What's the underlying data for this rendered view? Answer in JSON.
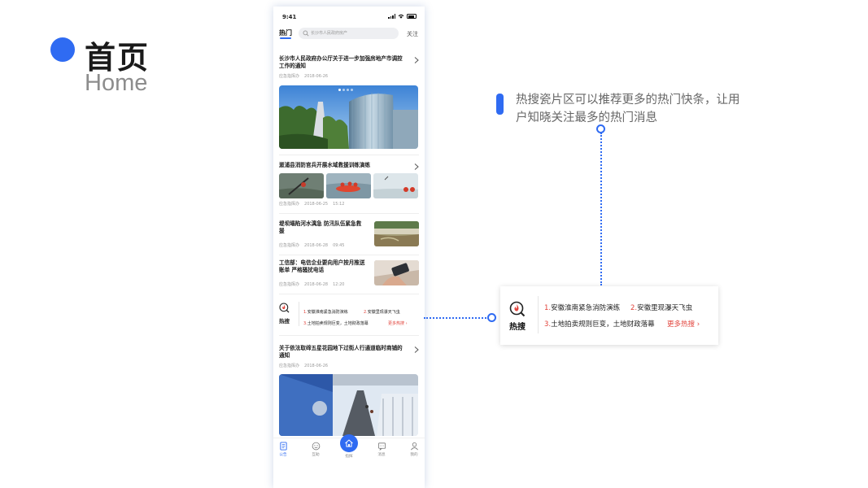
{
  "slide": {
    "title_zh": "首页",
    "title_en": "Home"
  },
  "colors": {
    "accent": "#2f6bf2",
    "hot_red": "#e2433b"
  },
  "phone": {
    "status": {
      "time": "9:41"
    },
    "nav": {
      "tab_hot": "热门",
      "search_placeholder": "长沙市人民政府房产",
      "tab_follow": "关注"
    },
    "feed": [
      {
        "title": "长沙市人民政府办公厅关于进一步加强房地产市调控工作的通知",
        "source": "应急指挥办",
        "date": "2018-06-26",
        "time": ""
      },
      {
        "title": "溆浦县消防官兵开展水域救援训练演练",
        "source": "应急指挥办",
        "date": "2018-06-25",
        "time": "15:12"
      },
      {
        "title": "堤坝塌陷河水漓急 防汛队伍紧急救援",
        "source": "应急指挥办",
        "date": "2018-06-28",
        "time": "09:45"
      },
      {
        "title": "工信部：电信企业要向用户按月推送账单 严格骚扰电话",
        "source": "应急指挥办",
        "date": "2018-06-28",
        "time": "12:20"
      },
      {
        "title": "关于依法取缔五星花园地下过街人行通道临时商铺的通知",
        "source": "应急指挥办",
        "date": "2018-06-26",
        "time": ""
      }
    ],
    "bottom_nav": [
      "公告",
      "互助",
      "指挥",
      "消息",
      "我的"
    ]
  },
  "hot_search": {
    "label": "热搜",
    "items": [
      {
        "num": "1.",
        "text": "安徽淮南紧急消防演练"
      },
      {
        "num": "2.",
        "text": "安徽里现瀑天飞虫"
      },
      {
        "num": "3.",
        "text": "土地拍卖规则巨变，土地财政落幕"
      }
    ],
    "more": "更多热搜"
  },
  "annotation": {
    "text": "热搜瓷片区可以推荐更多的热门快条，让用户知晓关注最多的热门消息"
  }
}
